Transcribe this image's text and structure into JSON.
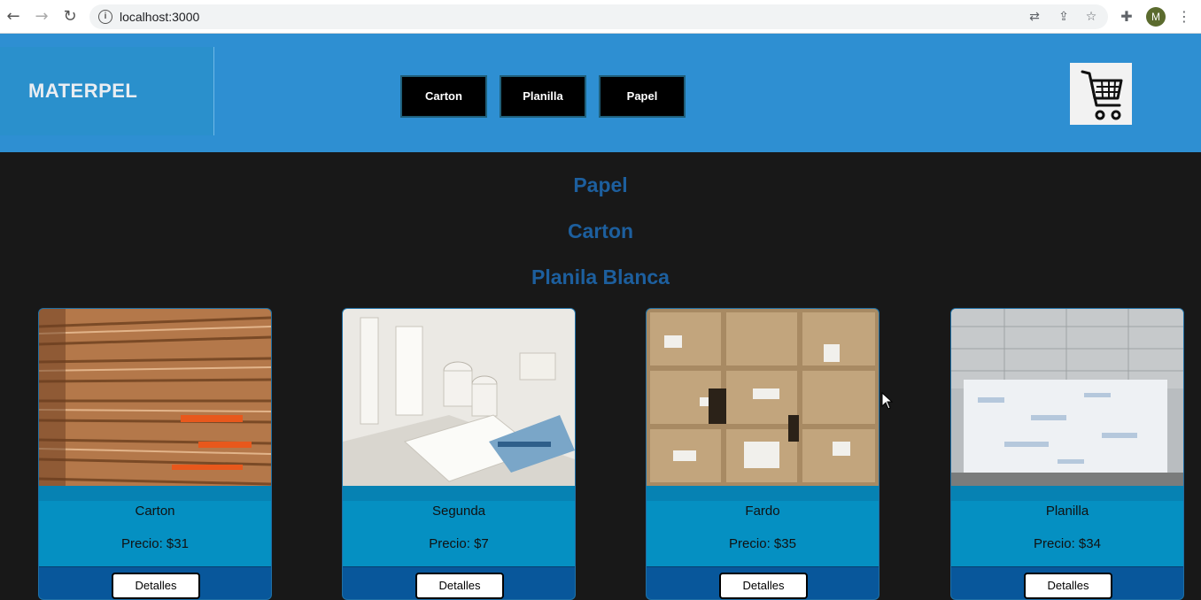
{
  "browser": {
    "url": "localhost:3000",
    "avatar_letter": "M"
  },
  "header": {
    "logo_text": "MATERPEL",
    "nav": [
      "Carton",
      "Planilla",
      "Papel"
    ],
    "cart_icon": "shopping-cart-icon"
  },
  "headings": [
    "Papel",
    "Carton",
    "Planila Blanca"
  ],
  "products": [
    {
      "name": "Carton",
      "price": "Precio: $31",
      "button": "Detalles"
    },
    {
      "name": "Segunda",
      "price": "Precio: $7",
      "button": "Detalles"
    },
    {
      "name": "Fardo",
      "price": "Precio: $35",
      "button": "Detalles"
    },
    {
      "name": "Planilla",
      "price": "Precio: $34",
      "button": "Detalles"
    }
  ],
  "colors": {
    "header_bg": "#2e8fd2",
    "page_bg": "#181818",
    "heading": "#1d5f9e",
    "card_bg": "#0590c2",
    "card_bottom": "#08579b"
  }
}
